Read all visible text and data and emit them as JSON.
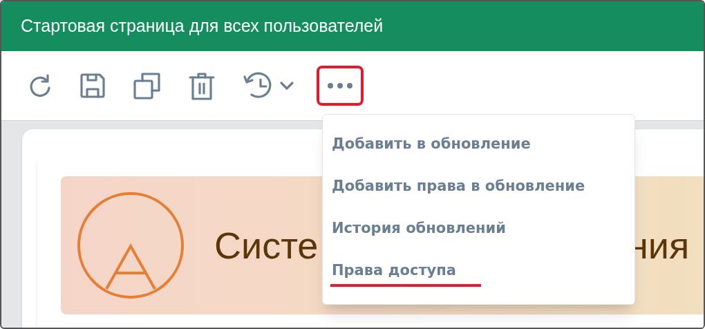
{
  "window": {
    "title": "Стартовая страница для всех пользователей"
  },
  "toolbar": [
    {
      "kind": "refresh",
      "highlighted": false
    },
    {
      "kind": "save",
      "highlighted": false
    },
    {
      "kind": "copy",
      "highlighted": false
    },
    {
      "kind": "delete",
      "highlighted": false
    },
    {
      "kind": "history",
      "highlighted": false
    },
    {
      "kind": "more",
      "highlighted": true
    }
  ],
  "banner": {
    "title_visible_parts": [
      "Систе",
      "ния"
    ]
  },
  "menu": {
    "items": [
      {
        "label": "Добавить в обновление",
        "marked": false
      },
      {
        "label": "Добавить права в обновление",
        "marked": false
      },
      {
        "label": "История обновлений",
        "marked": false
      },
      {
        "label": "Права доступа",
        "marked": true
      }
    ]
  }
}
